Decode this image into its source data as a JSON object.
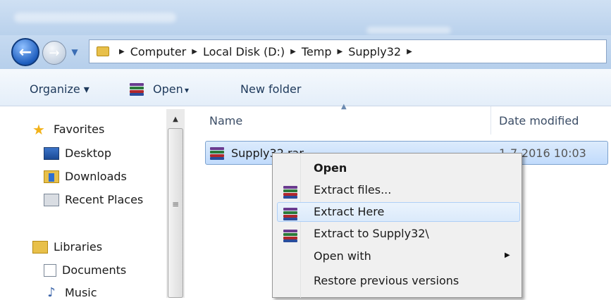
{
  "window": {
    "title_blurred": "Computer ▸ Local Disk (D:) ▸ Temp ▸",
    "title_blurred_right": "Documents"
  },
  "address": {
    "breadcrumbs": [
      "Computer",
      "Local Disk (D:)",
      "Temp",
      "Supply32"
    ]
  },
  "commandbar": {
    "organize": "Organize ▾",
    "open": "Open",
    "open_arrow": "▾",
    "new_folder": "New folder"
  },
  "navpane": {
    "favorites": "Favorites",
    "desktop": "Desktop",
    "downloads": "Downloads",
    "recent_places": "Recent Places",
    "libraries": "Libraries",
    "documents": "Documents",
    "music": "Music"
  },
  "filelist": {
    "col_name": "Name",
    "col_date": "Date modified",
    "file": {
      "name": "Supply32",
      "name_suffix": ".rar",
      "date": "1-7-2016 10:03"
    }
  },
  "context_menu": {
    "items": [
      "Open",
      "Extract files...",
      "Extract Here",
      "Extract to Supply32\\",
      "Open with",
      "Restore previous versions"
    ],
    "hovered": "Extract Here"
  },
  "colors": {
    "titlebar": "#c2d7ef",
    "selection": "#c1dbfc",
    "menu_bg": "#f0f0f0",
    "link_text": "#1e395b"
  }
}
